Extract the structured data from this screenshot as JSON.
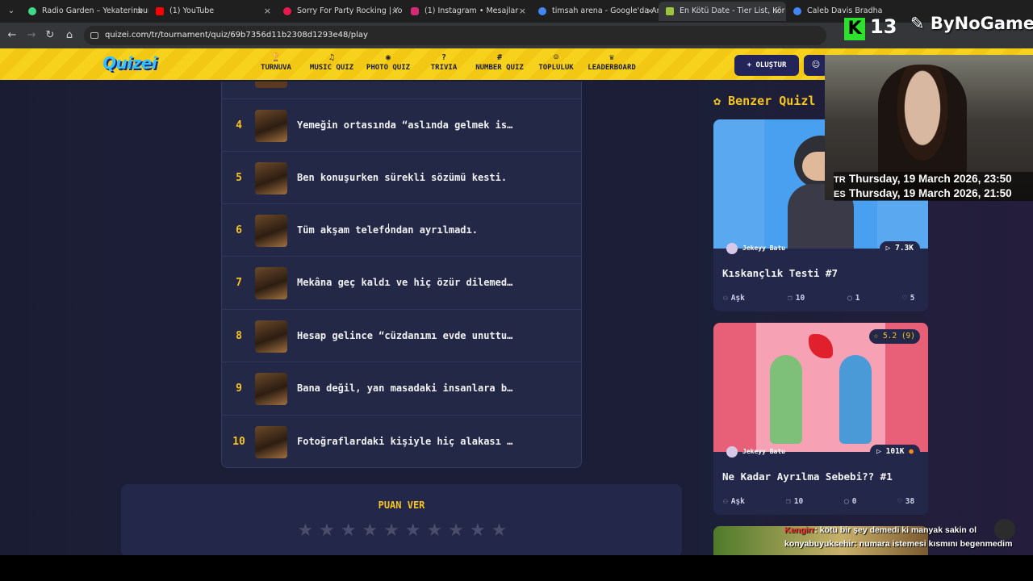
{
  "browser": {
    "tabs": [
      {
        "title": "Radio Garden – Yekaterinburg",
        "color": "#3ddc84"
      },
      {
        "title": "(1) YouTube",
        "color": "#ff0000"
      },
      {
        "title": "Sorry For Party Rocking | Yo",
        "color": "#e8194f"
      },
      {
        "title": "(1) Instagram • Mesajlar",
        "color": "#d62976"
      },
      {
        "title": "timsah arena - Google'da Ara",
        "color": "#4285f4"
      },
      {
        "title": "En Kötü Date - Tier List, Kör Sı",
        "color": "#9bc53d"
      },
      {
        "title": "Caleb Davis Bradham - Google",
        "color": "#4285f4"
      }
    ],
    "url": "quizei.com/tr/tournament/quiz/69b7356d11b2308d1293e48/play"
  },
  "site": {
    "logo": "Quizei",
    "nav": [
      {
        "label": "TURNUVA",
        "icon": "🏆"
      },
      {
        "label": "MUSIC QUIZ",
        "icon": "♫"
      },
      {
        "label": "PHOTO QUIZ",
        "icon": "◉"
      },
      {
        "label": "TRIVIA",
        "icon": "?"
      },
      {
        "label": "NUMBER QUIZ",
        "icon": "#"
      },
      {
        "label": "TOPLULUK",
        "icon": "☺"
      },
      {
        "label": "LEADERBOARD",
        "icon": "♛"
      }
    ],
    "create_label": "+ OLUŞTUR"
  },
  "list": {
    "rows": [
      {
        "rank": "4",
        "text": "Yemeğin ortasında “aslında gelmek is…"
      },
      {
        "rank": "5",
        "text": "Ben konuşurken sürekli sözümü kesti."
      },
      {
        "rank": "6",
        "text": "Tüm akşam telefondan ayrılmadı."
      },
      {
        "rank": "7",
        "text": "Mekâna geç kaldı ve hiç özür dilemed…"
      },
      {
        "rank": "8",
        "text": "Hesap gelince “cüzdanımı evde unuttu…"
      },
      {
        "rank": "9",
        "text": "Bana değil, yan masadaki insanlara b…"
      },
      {
        "rank": "10",
        "text": "Fotoğraflardaki kişiyle hiç alakası …"
      }
    ]
  },
  "rate": {
    "title": "PUAN VER",
    "stars": 10
  },
  "sidebar": {
    "title": "Benzer Quizl",
    "cards": [
      {
        "author": "Jekeyy Batu",
        "plays": "▷ 7.3K",
        "title": "Kıskançlık Testi #7",
        "category": "Aşk",
        "questions": "10",
        "comments": "1",
        "likes": "5"
      },
      {
        "author": "Jekeyy Batu",
        "plays": "▷ 101K",
        "rating": "☆ 5.2 (9)",
        "title": "Ne Kadar Ayrılma Sebebi?? #1",
        "category": "Aşk",
        "questions": "10",
        "comments": "0",
        "likes": "38"
      }
    ]
  },
  "overlay": {
    "brand_letter": "K",
    "brand_number": "13",
    "brand_name": "ByNoGame",
    "clock_tr": {
      "tz": "TR",
      "text": "Thursday, 19 March 2026, 23:50"
    },
    "clock_es": {
      "tz": "ES",
      "text": "Thursday, 19 March 2026, 21:50"
    },
    "chat": [
      {
        "user": "Kengirr",
        "msg": ": kötü bir şey demedi ki manyak sakin ol"
      },
      {
        "user": "konyabuyuksehir",
        "msg": ": numara istemesi kısmını begenmedim"
      }
    ]
  }
}
